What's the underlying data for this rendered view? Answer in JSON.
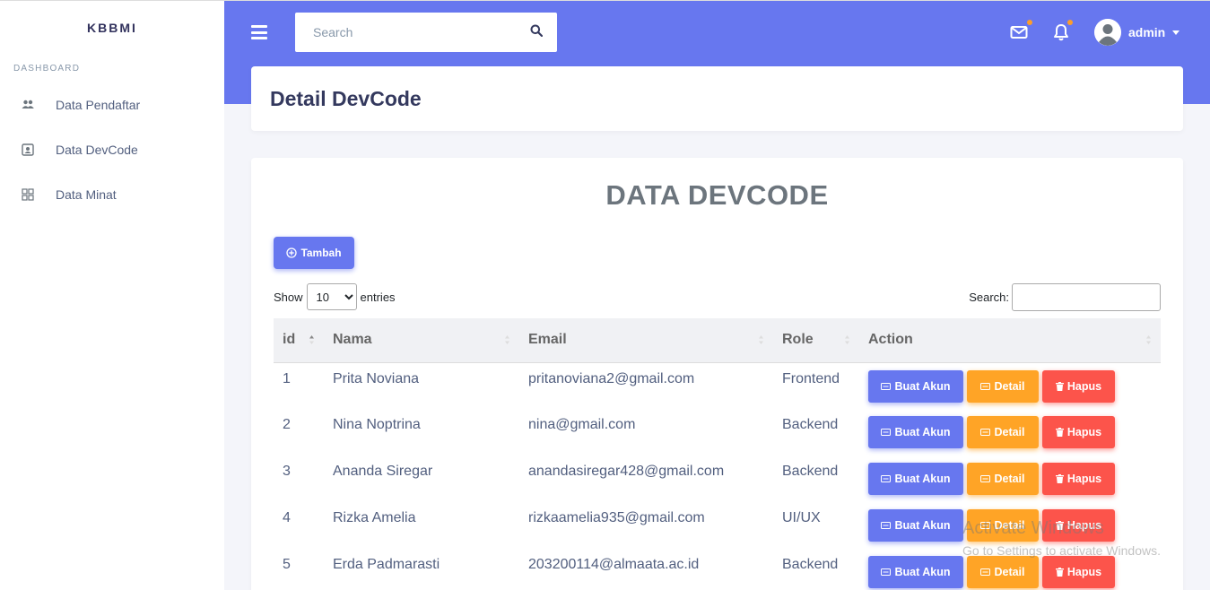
{
  "sidebar": {
    "brand": "KBBMI",
    "heading": "DASHBOARD",
    "items": [
      {
        "label": "Data Pendaftar",
        "icon": "users-icon"
      },
      {
        "label": "Data DevCode",
        "icon": "id-card-icon"
      },
      {
        "label": "Data Minat",
        "icon": "grid-icon"
      }
    ]
  },
  "topbar": {
    "search_placeholder": "Search",
    "user_name": "admin"
  },
  "header": {
    "title": "Detail DevCode"
  },
  "main": {
    "title": "DATA DEVCODE",
    "add_button": "Tambah",
    "show_label": "Show",
    "entries_value": "10",
    "entries_label": "entries",
    "search_label": "Search:"
  },
  "table": {
    "columns": [
      "id",
      "Nama",
      "Email",
      "Role",
      "Action"
    ],
    "rows": [
      {
        "id": "1",
        "nama": "Prita Noviana",
        "email": "pritanoviana2@gmail.com",
        "role": "Frontend"
      },
      {
        "id": "2",
        "nama": "Nina Noptrina",
        "email": "nina@gmail.com",
        "role": "Backend"
      },
      {
        "id": "3",
        "nama": "Ananda Siregar",
        "email": "anandasiregar428@gmail.com",
        "role": "Backend"
      },
      {
        "id": "4",
        "nama": "Rizka Amelia",
        "email": "rizkaamelia935@gmail.com",
        "role": "UI/UX"
      },
      {
        "id": "5",
        "nama": "Erda Padmarasti",
        "email": "203200114@almaata.ac.id",
        "role": "Backend"
      }
    ],
    "action_labels": {
      "buat": "Buat Akun",
      "detail": "Detail",
      "hapus": "Hapus"
    }
  },
  "watermark": {
    "line1": "Activate Windows",
    "line2": "Go to Settings to activate Windows."
  },
  "colors": {
    "primary": "#6777ef",
    "warning": "#ffa426",
    "danger": "#fc544b",
    "notification_dot": "#fc9d2b"
  }
}
